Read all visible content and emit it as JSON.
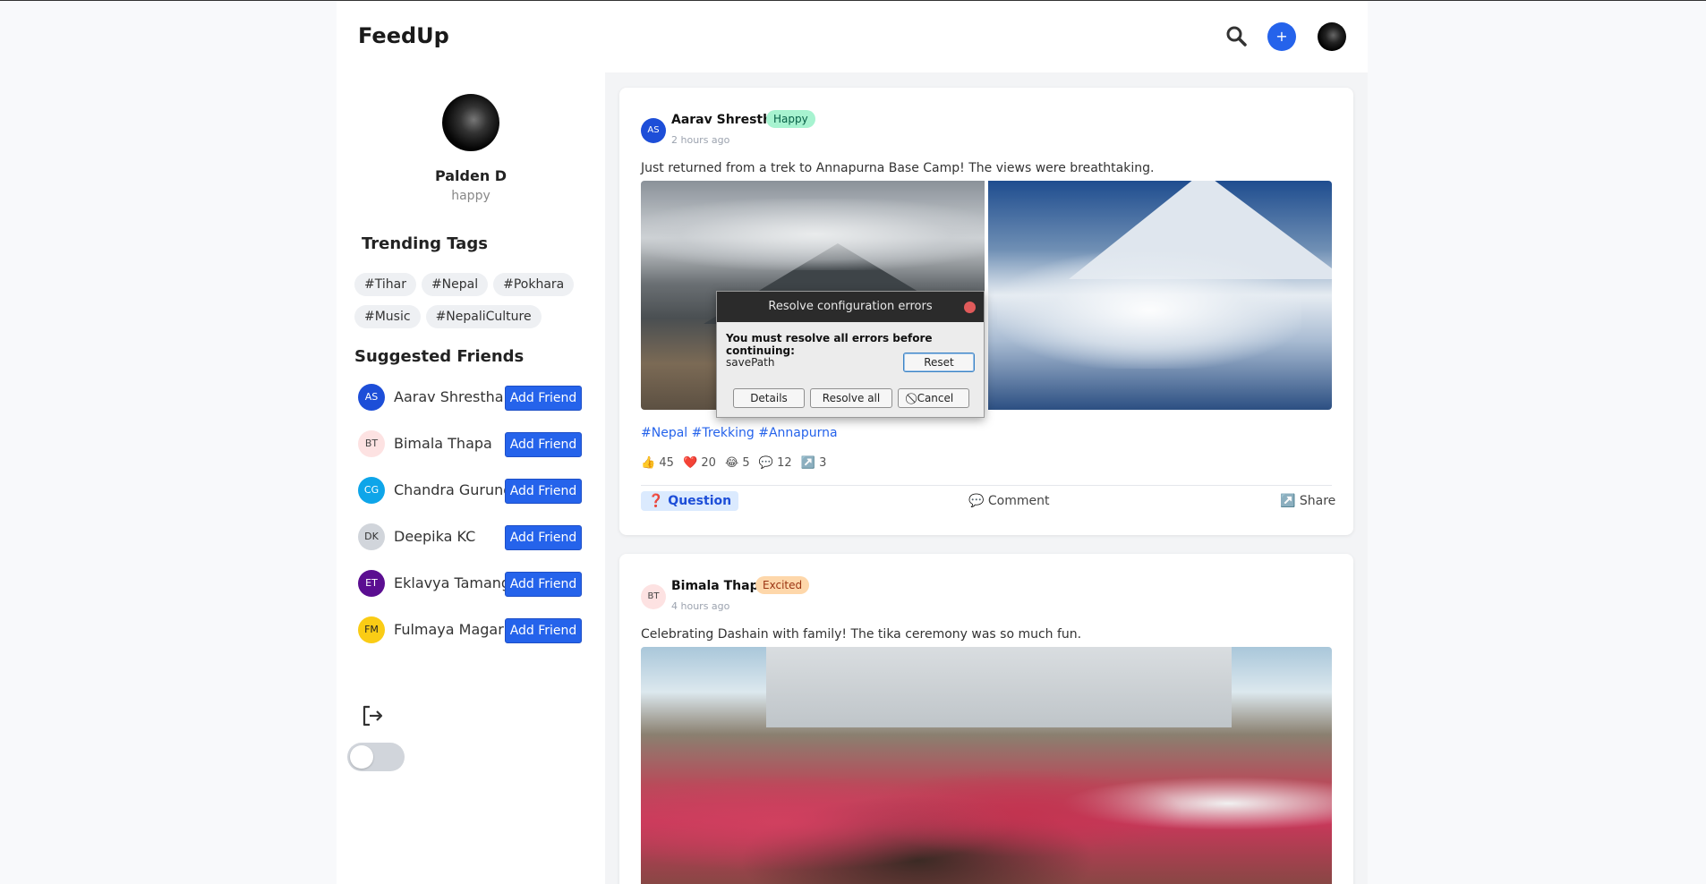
{
  "header": {
    "brand": "FeedUp",
    "plus_label": "+"
  },
  "profile": {
    "name": "Palden D",
    "mood": "happy"
  },
  "trending": {
    "title": "Trending Tags",
    "tags": [
      "#Tihar",
      "#Nepal",
      "#Pokhara",
      "#Music",
      "#NepaliCulture"
    ]
  },
  "suggested": {
    "title": "Suggested Friends",
    "add_label": "Add Friend",
    "friends": [
      {
        "initials": "AS",
        "name": "Aarav Shrestha",
        "bg": "#1d4ed8",
        "fg": "#ffffff"
      },
      {
        "initials": "BT",
        "name": "Bimala Thapa",
        "bg": "#fde2e2",
        "fg": "#444444"
      },
      {
        "initials": "CG",
        "name": "Chandra Gurung",
        "bg": "#0ea5e9",
        "fg": "#ffffff"
      },
      {
        "initials": "DK",
        "name": "Deepika KC",
        "bg": "#d1d5db",
        "fg": "#333333"
      },
      {
        "initials": "ET",
        "name": "Eklavya Tamang",
        "bg": "#5b0e91",
        "fg": "#ffffff"
      },
      {
        "initials": "FM",
        "name": "Fulmaya Magar",
        "bg": "#facc15",
        "fg": "#222222"
      }
    ]
  },
  "posts": [
    {
      "initials": "AS",
      "author": "Aarav Shrestha",
      "mood": "Happy",
      "time": "2 hours ago",
      "text": "Just returned from a trek to Annapurna Base Camp! The views were breathtaking.",
      "tags": "#Nepal #Trekking #Annapurna",
      "stats": {
        "likes": "👍 45",
        "hearts": "❤️ 20",
        "laughs": "😂 5",
        "comments": "💬 12",
        "shares": "↗️ 3"
      },
      "actions": {
        "question": "❓ Question",
        "comment": "💬 Comment",
        "share": "↗️ Share"
      }
    },
    {
      "initials": "BT",
      "author": "Bimala Thapa",
      "mood": "Excited",
      "time": "4 hours ago",
      "text": "Celebrating Dashain with family! The tika ceremony was so much fun."
    }
  ],
  "dialog": {
    "title": "Resolve configuration errors",
    "message": "You must resolve all errors before continuing:",
    "field": "savePath",
    "reset": "Reset",
    "details": "Details",
    "resolve_all": "Resolve all",
    "cancel": "Cancel"
  },
  "colors": {
    "accent": "#2563eb",
    "happy_badge": "#a7f3d0",
    "excited_badge": "#fed7aa"
  }
}
